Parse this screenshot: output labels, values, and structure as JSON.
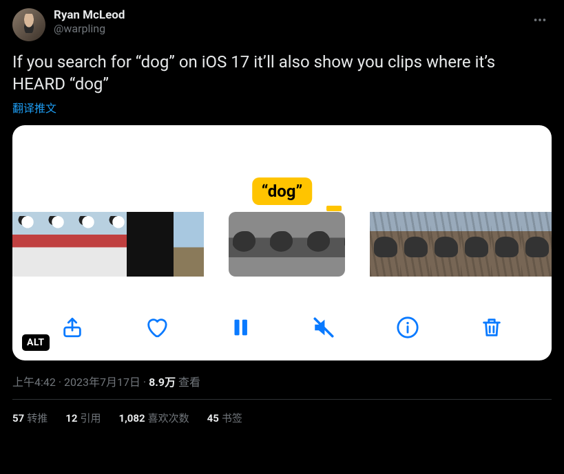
{
  "author": {
    "display_name": "Ryan McLeod",
    "handle": "@warpling"
  },
  "tweet_text": "If you search for “dog” on iOS 17 it’ll also show you clips where it’s HEARD “dog”",
  "translate_label": "翻译推文",
  "media": {
    "highlight_label": "“dog”",
    "alt_badge": "ALT",
    "toolbar": {
      "share": "share-icon",
      "like": "heart-icon",
      "pause": "pause-icon",
      "mute": "mute-icon",
      "info": "info-icon",
      "delete": "trash-icon"
    }
  },
  "meta": {
    "time": "上午4:42",
    "sep1": " · ",
    "date": "2023年7月17日",
    "sep2": " · ",
    "views_num": "8.9万",
    "views_label": " 查看"
  },
  "stats": {
    "retweets_count": "57",
    "retweets_label": "转推",
    "quotes_count": "12",
    "quotes_label": "引用",
    "likes_count": "1,082",
    "likes_label": "喜欢次数",
    "bookmarks_count": "45",
    "bookmarks_label": "书签"
  }
}
